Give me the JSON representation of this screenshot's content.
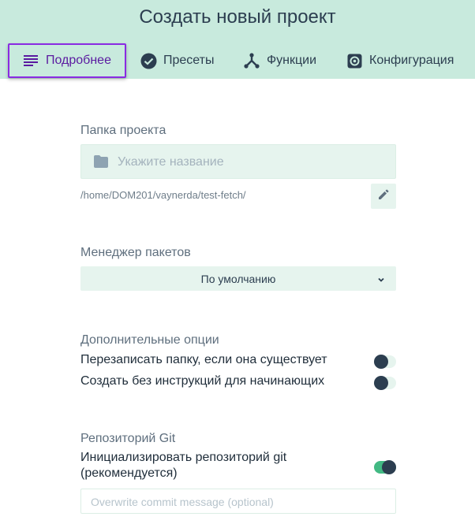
{
  "header": {
    "title": "Создать новый проект"
  },
  "tabs": [
    {
      "label": "Подробнее",
      "icon": "list-icon",
      "active": true
    },
    {
      "label": "Пресеты",
      "icon": "check-circle-icon",
      "active": false
    },
    {
      "label": "Функции",
      "icon": "branch-icon",
      "active": false
    },
    {
      "label": "Конфигурация",
      "icon": "gear-icon",
      "active": false
    }
  ],
  "project_folder": {
    "label": "Папка проекта",
    "placeholder": "Укажите название",
    "value": "",
    "path": "/home/DOM201/vaynerda/test-fetch/"
  },
  "package_manager": {
    "label": "Менеджер пакетов",
    "selected": "По умолчанию"
  },
  "options": {
    "label": "Дополнительные опции",
    "items": [
      {
        "label": "Перезаписать папку, если она существует",
        "enabled": false
      },
      {
        "label": "Создать без инструкций для начинающих",
        "enabled": false
      }
    ]
  },
  "git": {
    "label": "Репозиторий Git",
    "init_label": "Инициализировать репозиторий git (рекомендуется)",
    "init_enabled": true,
    "commit_placeholder": "Overwrite commit message (optional)"
  },
  "colors": {
    "accent": "#42b983",
    "header_bg": "#c8eadd",
    "active_tab_border": "#8a2be2",
    "text_dark": "#2c3e50"
  }
}
